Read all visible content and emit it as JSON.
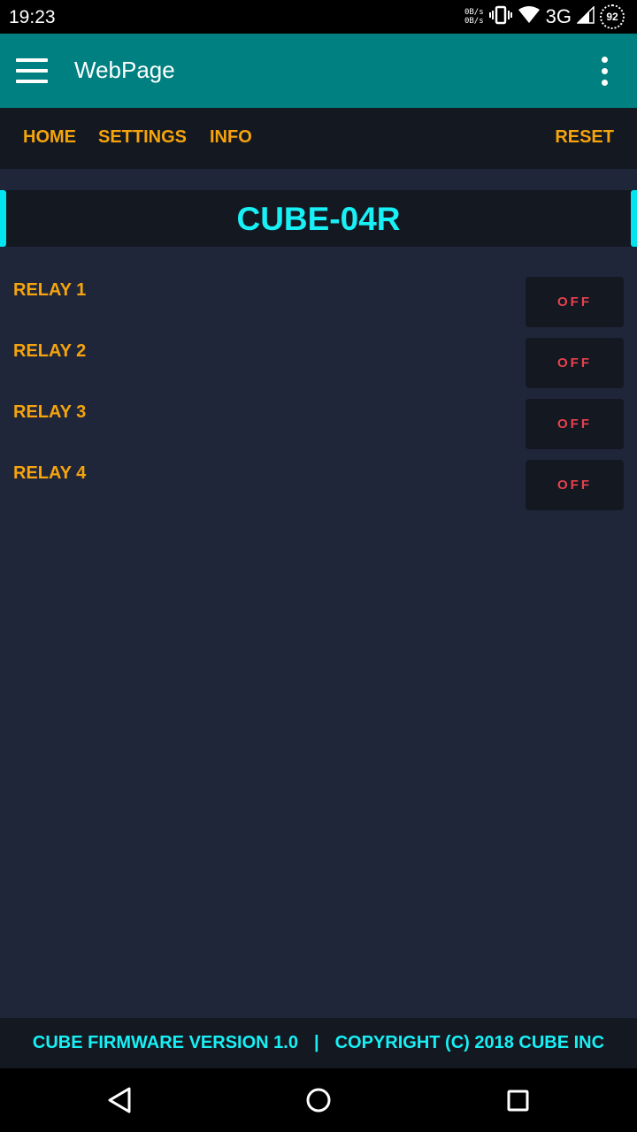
{
  "status_bar": {
    "time": "19:23",
    "net_up": "0B/s",
    "net_down": "0B/s",
    "network": "3G",
    "battery": "92"
  },
  "app_bar": {
    "title": "WebPage",
    "menu_icon": "hamburger-icon",
    "overflow_icon": "more-vert-icon"
  },
  "nav": {
    "home": "HOME",
    "settings": "SETTINGS",
    "info": "INFO",
    "reset": "RESET"
  },
  "device": {
    "title": "CUBE-04R"
  },
  "relays": [
    {
      "label": "RELAY 1",
      "state": "OFF"
    },
    {
      "label": "RELAY 2",
      "state": "OFF"
    },
    {
      "label": "RELAY 3",
      "state": "OFF"
    },
    {
      "label": "RELAY 4",
      "state": "OFF"
    }
  ],
  "footer": {
    "version": "CUBE FIRMWARE VERSION 1.0",
    "separator": "|",
    "copyright": "COPYRIGHT (C) 2018 CUBE INC"
  },
  "colors": {
    "app_bar": "#008080",
    "accent_orange": "#f5a40d",
    "accent_cyan": "#18f0f5",
    "off_red": "#e8414f",
    "background": "#20263a",
    "panel": "#141821"
  }
}
